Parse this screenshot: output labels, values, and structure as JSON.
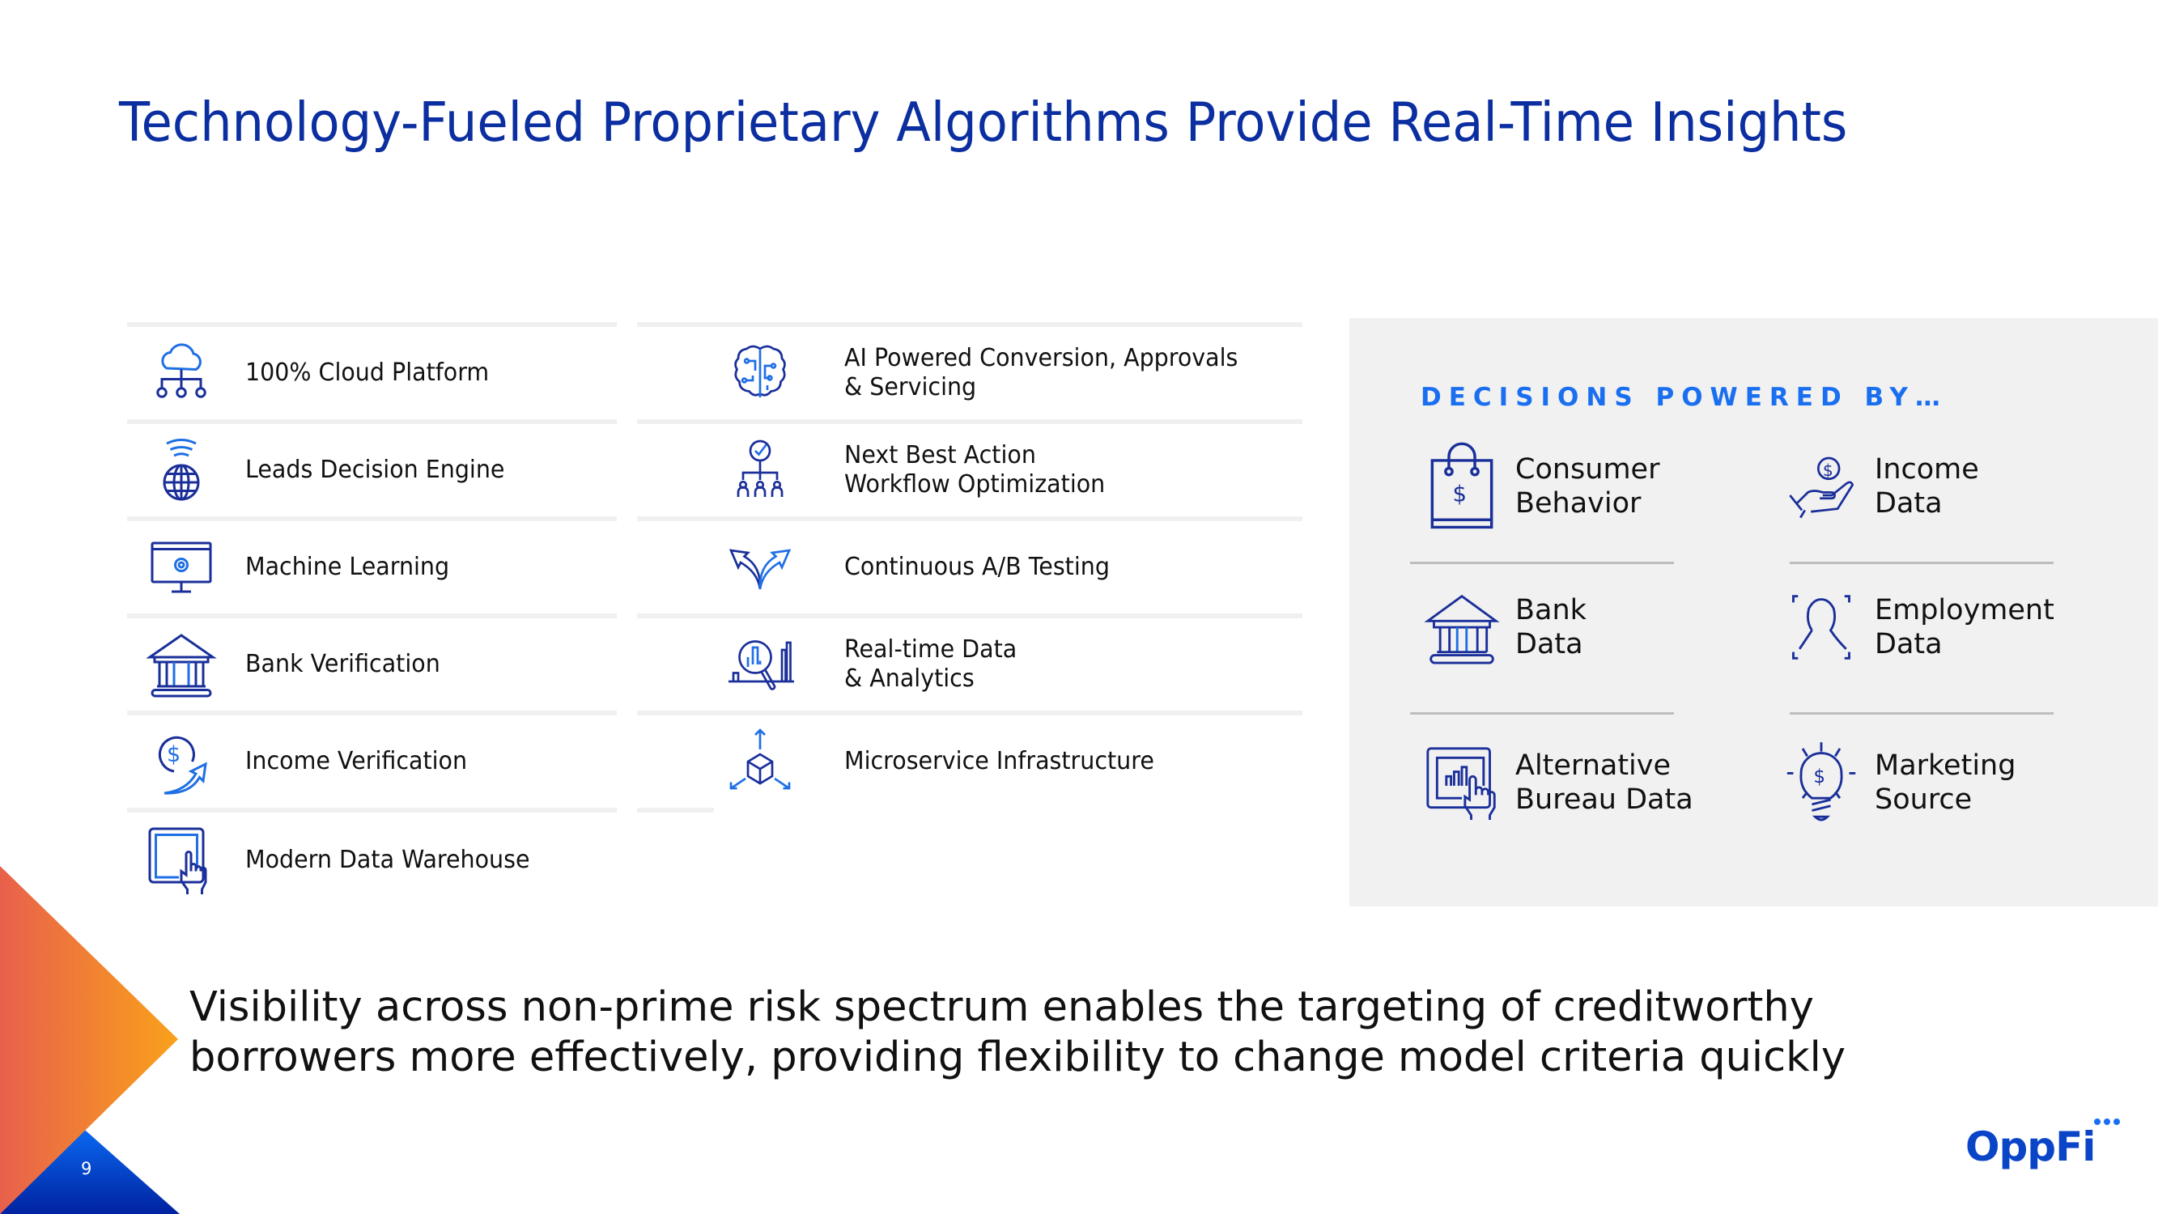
{
  "slide": {
    "title": "Technology-Fueled Proprietary Algorithms Provide Real-Time Insights",
    "page_number": "9",
    "brand": "OppFi",
    "colors": {
      "title": "#0b2ea0",
      "accent_blue": "#1a6ff0",
      "icon_navy": "#1a2f9a",
      "icon_blue": "#1f6fe5",
      "panel_bg": "#f1f1f1",
      "orange": "#f7941d",
      "coral": "#e8604c",
      "deep_blue": "#0029a0"
    }
  },
  "capabilities": {
    "left": [
      {
        "icon": "cloud-network-icon",
        "label": "100% Cloud Platform"
      },
      {
        "icon": "globe-signal-icon",
        "label": "Leads Decision Engine"
      },
      {
        "icon": "monitor-gear-icon",
        "label": "Machine Learning"
      },
      {
        "icon": "bank-icon",
        "label": "Bank Verification"
      },
      {
        "icon": "dollar-arrow-icon",
        "label": "Income Verification"
      },
      {
        "icon": "tablet-touch-icon",
        "label": "Modern Data Warehouse"
      }
    ],
    "right": [
      {
        "icon": "ai-brain-icon",
        "label": "AI Powered Conversion, Approvals\n& Servicing"
      },
      {
        "icon": "org-check-icon",
        "label": "Next Best Action\nWorkflow Optimization"
      },
      {
        "icon": "split-arrows-icon",
        "label": "Continuous A/B Testing"
      },
      {
        "icon": "analytics-magnifier-icon",
        "label": "Real-time Data\n& Analytics"
      },
      {
        "icon": "cube-arrows-icon",
        "label": "Microservice Infrastructure"
      }
    ]
  },
  "decisions_panel": {
    "heading": "DECISIONS POWERED BY…",
    "items": [
      {
        "icon": "shopping-bag-dollar-icon",
        "label": "Consumer\nBehavior"
      },
      {
        "icon": "hand-coin-icon",
        "label": "Income\nData"
      },
      {
        "icon": "bank-icon",
        "label": "Bank\nData"
      },
      {
        "icon": "person-scan-icon",
        "label": "Employment\nData"
      },
      {
        "icon": "tablet-chart-touch-icon",
        "label": "Alternative\nBureau Data"
      },
      {
        "icon": "lightbulb-dollar-icon",
        "label": "Marketing\nSource"
      }
    ]
  },
  "footer": {
    "statement": "Visibility across non-prime risk spectrum enables the targeting of creditworthy\nborrowers more effectively, providing flexibility to change model criteria quickly"
  }
}
